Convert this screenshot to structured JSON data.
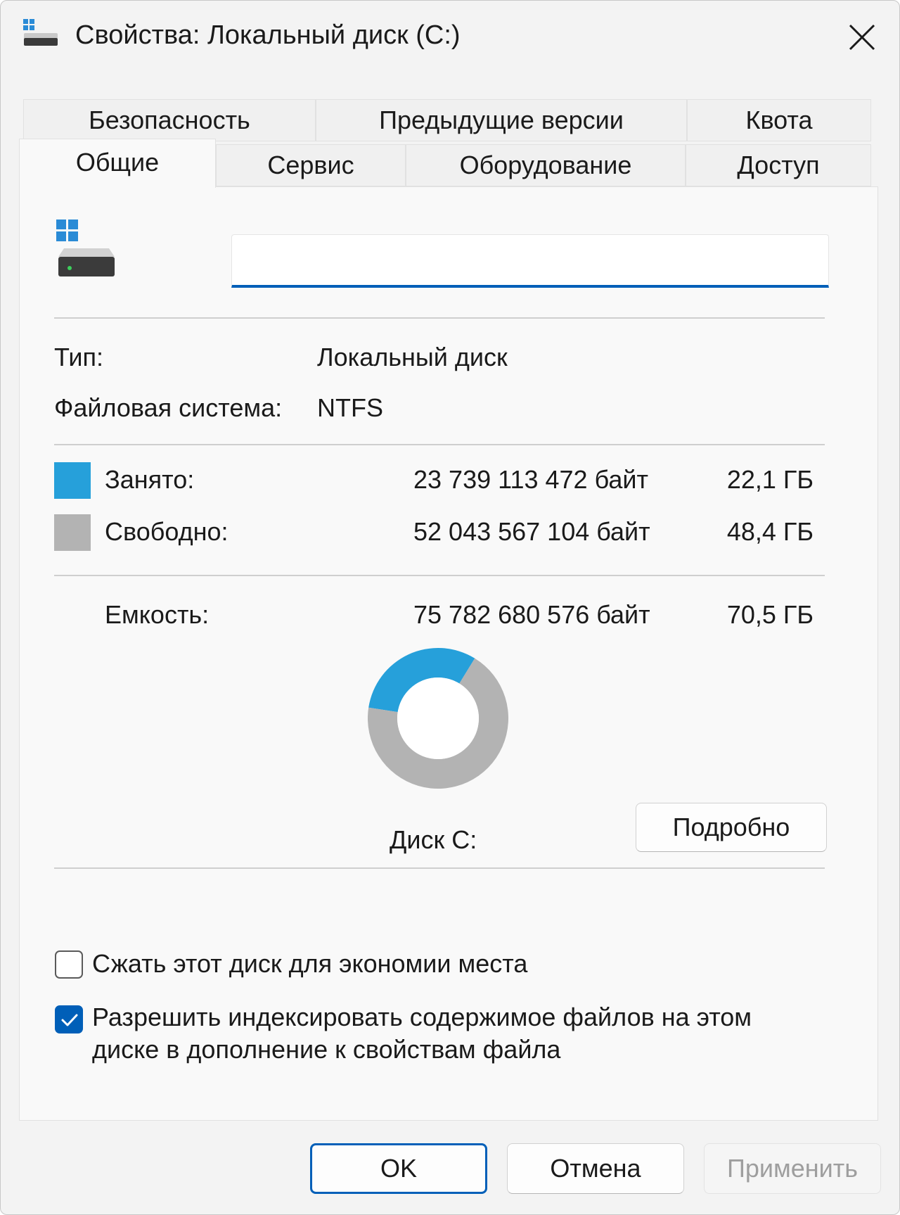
{
  "window": {
    "title": "Свойства: Локальный диск (C:)"
  },
  "tabs": {
    "back_row": [
      "Безопасность",
      "Предыдущие версии",
      "Квота"
    ],
    "front_row": [
      "Общие",
      "Сервис",
      "Оборудование",
      "Доступ"
    ],
    "active": "Общие"
  },
  "general": {
    "name_value": "",
    "type_label": "Тип:",
    "type_value": "Локальный диск",
    "fs_label": "Файловая система:",
    "fs_value": "NTFS",
    "used_label": "Занято:",
    "used_bytes": "23 739 113 472 байт",
    "used_size": "22,1 ГБ",
    "free_label": "Свободно:",
    "free_bytes": "52 043 567 104 байт",
    "free_size": "48,4 ГБ",
    "capacity_label": "Емкость:",
    "capacity_bytes": "75 782 680 576 байт",
    "capacity_size": "70,5 ГБ",
    "disk_label": "Диск C:",
    "details_button": "Подробно",
    "compress_label": "Сжать этот диск для экономии места",
    "compress_checked": false,
    "index_label_line1": "Разрешить индексировать содержимое файлов на этом",
    "index_label_line2": "диске в дополнение к свойствам файла",
    "index_checked": true
  },
  "chart_data": {
    "type": "pie",
    "donut": true,
    "series": [
      {
        "name": "Занято",
        "value": 23739113472,
        "color": "#26a0da"
      },
      {
        "name": "Свободно",
        "value": 52043567104,
        "color": "#b3b3b3"
      }
    ]
  },
  "colors": {
    "used": "#26a0da",
    "free": "#b3b3b3",
    "accent": "#005fb8"
  },
  "footer": {
    "ok": "OK",
    "cancel": "Отмена",
    "apply": "Применить"
  }
}
